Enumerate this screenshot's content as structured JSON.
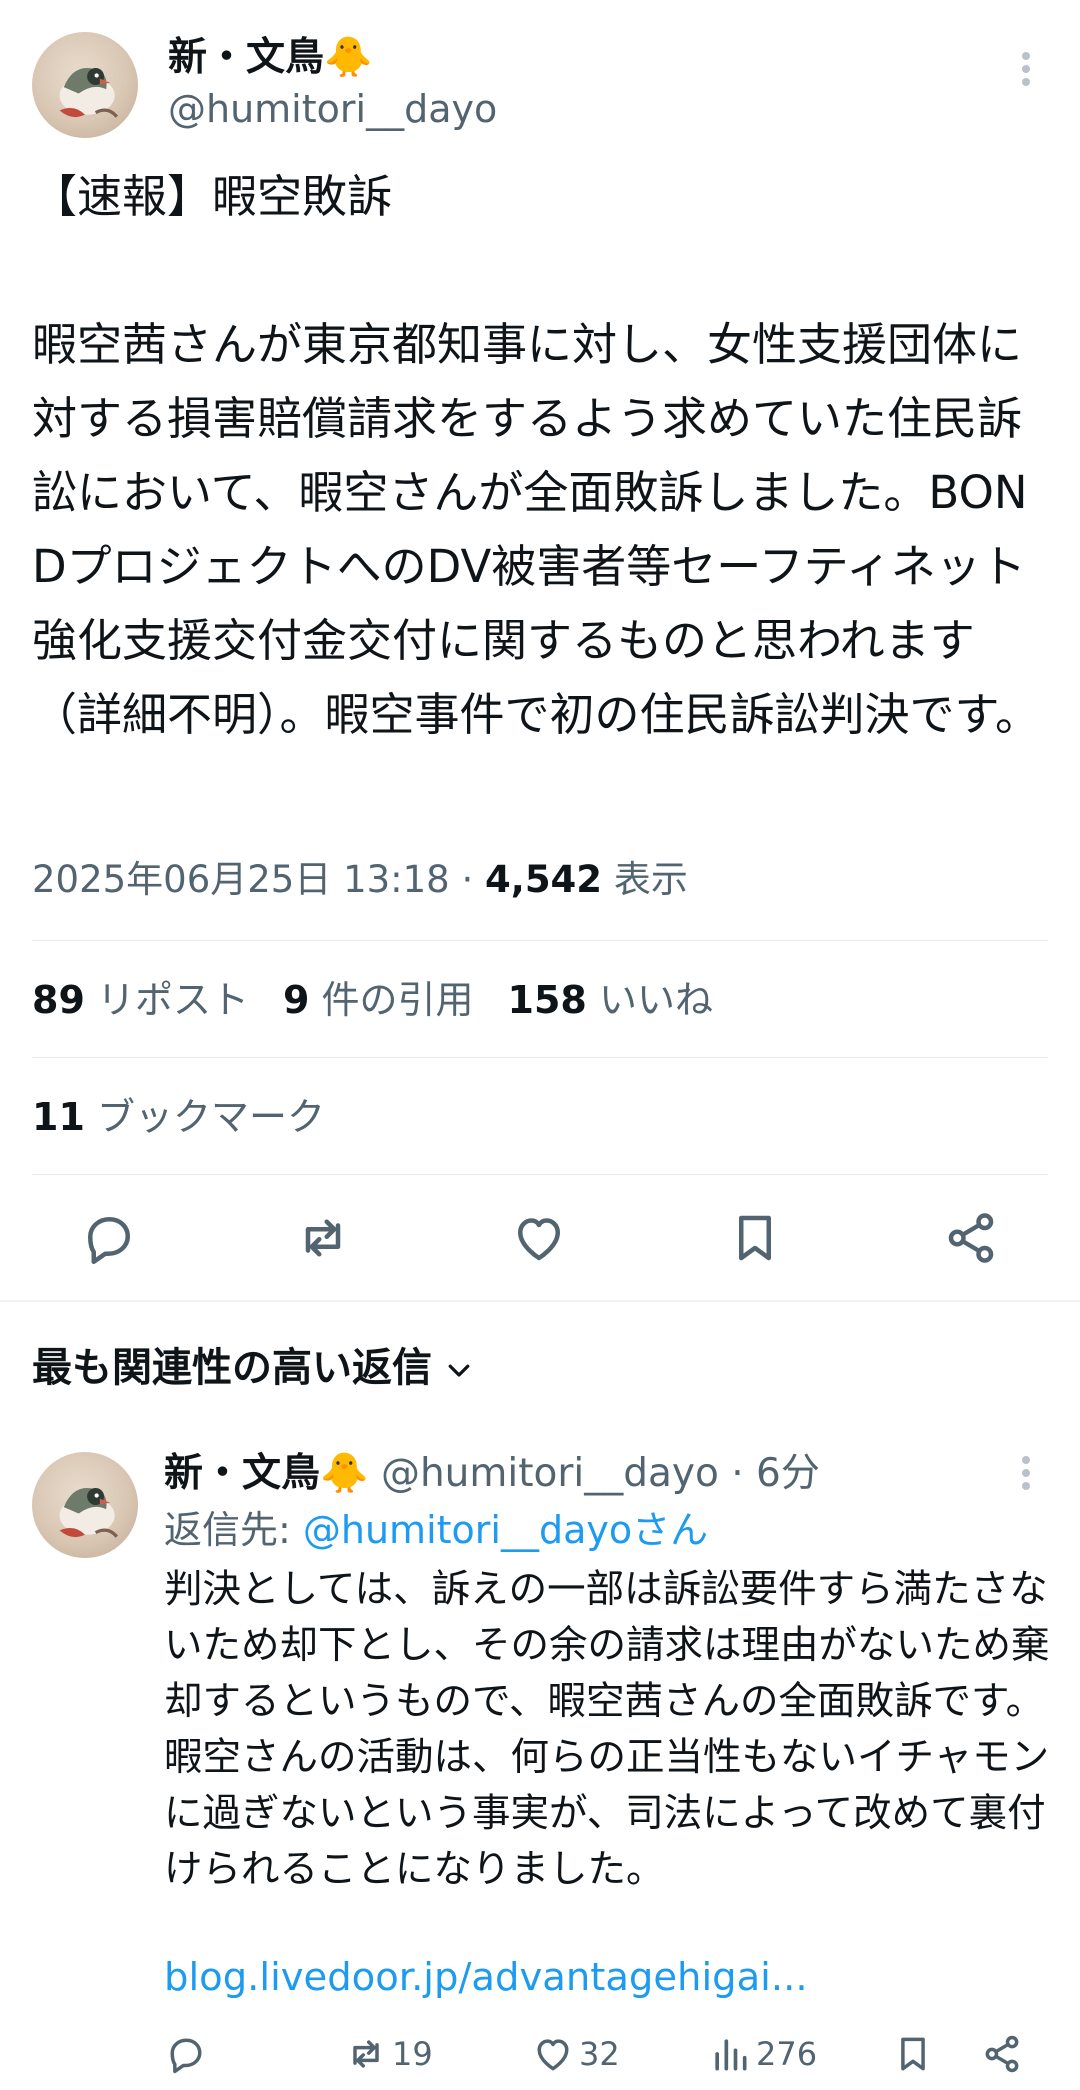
{
  "author": {
    "name": "新・文鳥🐥",
    "handle": "@humitori__dayo"
  },
  "tweet": {
    "text": "【速報】暇空敗訴\n\n暇空茜さんが東京都知事に対し、女性支援団体に対する損害賠償請求をするよう求めていた住民訴訟において、暇空さんが全面敗訴しました。BONDプロジェクトへのDV被害者等セーフティネット強化支援交付金交付に関するものと思われます（詳細不明）。暇空事件で初の住民訴訟判決です。",
    "timestamp": "2025年06月25日 13:18",
    "separator": " · ",
    "views": "4,542",
    "views_label": " 表示"
  },
  "stats": {
    "reposts": "89",
    "reposts_label": " リポスト",
    "quotes": "9",
    "quotes_label": " 件の引用",
    "likes": "158",
    "likes_label": " いいね",
    "bookmarks": "11",
    "bookmarks_label": " ブックマーク"
  },
  "actions": {
    "icons": [
      "reply-icon",
      "repost-icon",
      "like-icon",
      "bookmark-icon",
      "share-icon"
    ]
  },
  "replies_section": {
    "title": "最も関連性の高い返信"
  },
  "reply": {
    "name": "新・文鳥🐥",
    "handle_time": " @humitori__dayo · 6分",
    "reply_to_prefix": "返信先: ",
    "reply_to_handle": "@humitori__dayoさん",
    "text": "判決としては、訴えの一部は訴訟要件すら満たさないため却下とし、その余の請求は理由がないため棄却するというもので、暇空茜さんの全面敗訴です。暇空さんの活動は、何らの正当性もないイチャモンに過ぎないという事実が、司法によって改めて裏付けられることになりました。",
    "link": "blog.livedoor.jp/advantagehigai...",
    "reposts": "19",
    "likes": "32",
    "views": "276"
  },
  "colors": {
    "text": "#0f1419",
    "secondary": "#536471",
    "link": "#1d9bf0",
    "divider": "#e7ebee"
  }
}
